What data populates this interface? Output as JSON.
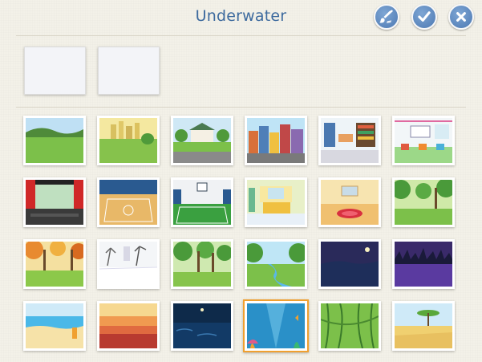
{
  "header": {
    "title": "Underwater",
    "buttons": [
      {
        "name": "paintbrush-button",
        "icon": "paintbrush-icon"
      },
      {
        "name": "confirm-button",
        "icon": "checkmark-icon"
      },
      {
        "name": "close-button",
        "icon": "close-icon"
      }
    ]
  },
  "custom_backgrounds": [
    {
      "name": "blank-background-1"
    },
    {
      "name": "blank-background-2"
    }
  ],
  "backgrounds": [
    {
      "id": "farm"
    },
    {
      "id": "city-park"
    },
    {
      "id": "suburb"
    },
    {
      "id": "city"
    },
    {
      "id": "library"
    },
    {
      "id": "classroom"
    },
    {
      "id": "theater"
    },
    {
      "id": "gym"
    },
    {
      "id": "basketball-court"
    },
    {
      "id": "bedroom"
    },
    {
      "id": "room"
    },
    {
      "id": "forest"
    },
    {
      "id": "autumn"
    },
    {
      "id": "winter"
    },
    {
      "id": "woods"
    },
    {
      "id": "river"
    },
    {
      "id": "night"
    },
    {
      "id": "night-forest"
    },
    {
      "id": "beach"
    },
    {
      "id": "sunset"
    },
    {
      "id": "night-sea"
    },
    {
      "id": "underwater"
    },
    {
      "id": "jungle"
    },
    {
      "id": "savanna"
    }
  ],
  "selected_background": "underwater",
  "colors": {
    "title": "#3d6a9e",
    "button": "#5a86bd",
    "selection": "#f0a030"
  }
}
